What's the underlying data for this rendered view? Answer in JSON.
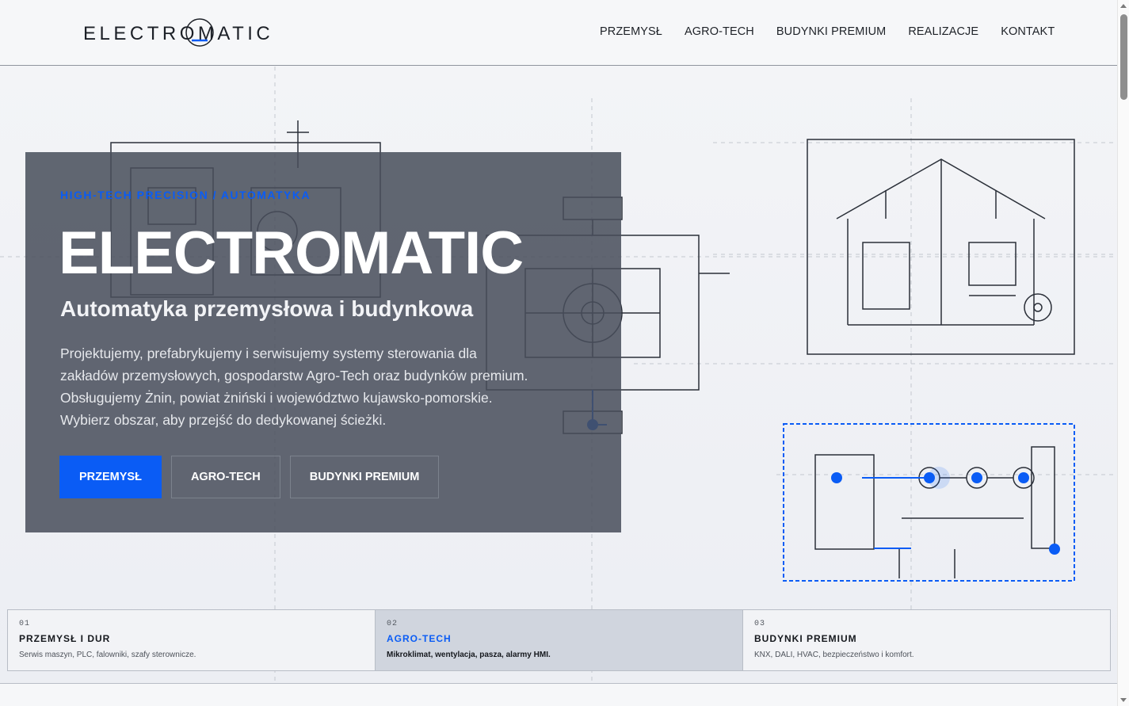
{
  "header": {
    "logo_text": "ELECTROMATIC",
    "nav": [
      "PRZEMYSŁ",
      "AGRO-TECH",
      "BUDYNKI PREMIUM",
      "REALIZACJE",
      "KONTAKT"
    ]
  },
  "hero": {
    "eyebrow": "HIGH-TECH PRECISION / AUTOMATYKA",
    "title": "ELECTROMATIC",
    "subtitle": "Automatyka przemysłowa i budynkowa",
    "description": [
      "Projektujemy, prefabrykujemy i serwisujemy systemy sterowania dla",
      "zakładów przemysłowych, gospodarstw Agro-Tech oraz budynków premium.",
      "Obsługujemy Żnin, powiat żniński i województwo kujawsko-pomorskie.",
      "Wybierz obszar, aby przejść do dedykowanej ścieżki."
    ],
    "buttons": {
      "primary": "PRZEMYSŁ",
      "secondary": "AGRO-TECH",
      "tertiary": "BUDYNKI PREMIUM"
    }
  },
  "cards": [
    {
      "num": "01",
      "title": "PRZEMYSŁ I DUR",
      "desc": "Serwis maszyn, PLC, falowniki, szafy sterownicze."
    },
    {
      "num": "02",
      "title": "AGRO-TECH",
      "desc": "Mikroklimat, wentylacja, pasza, alarmy HMI."
    },
    {
      "num": "03",
      "title": "BUDYNKI PREMIUM",
      "desc": "KNX, DALI, HVAC, bezpieczeństwo i komfort."
    }
  ],
  "colors": {
    "accent": "#0a5cf5",
    "panel": "#484e5b",
    "line": "#2a2f38"
  },
  "icons": {
    "logo": "electromatic-logo",
    "scroll_up": "chevron-up-icon",
    "scroll_down": "chevron-down-icon"
  }
}
